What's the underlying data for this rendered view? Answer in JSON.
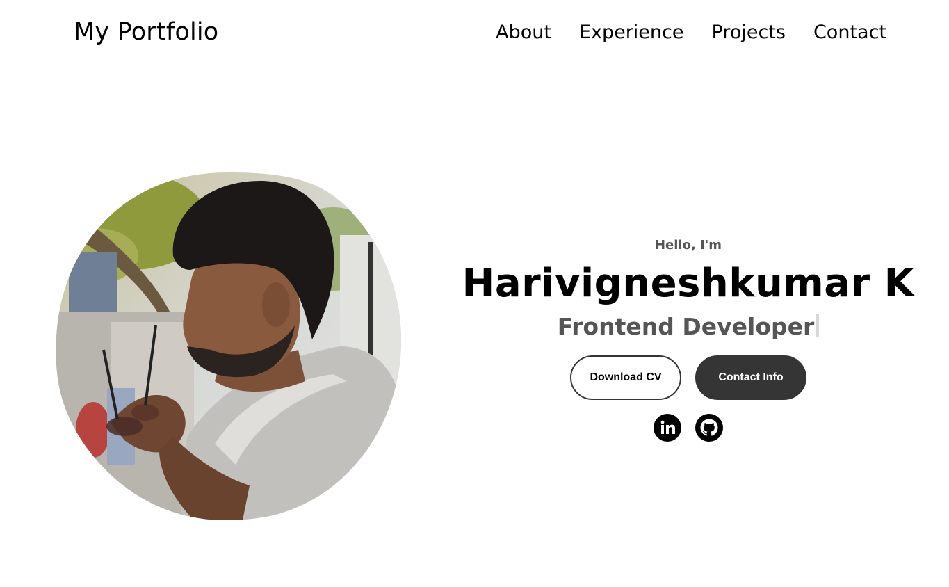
{
  "header": {
    "logo": "My Portfolio",
    "nav": [
      {
        "label": "About"
      },
      {
        "label": "Experience"
      },
      {
        "label": "Projects"
      },
      {
        "label": "Contact"
      }
    ]
  },
  "hero": {
    "greeting": "Hello, I'm",
    "name": "Harivigneshkumar K",
    "role": "Frontend Developer",
    "buttons": {
      "download": "Download CV",
      "contact": "Contact Info"
    },
    "socials": [
      {
        "icon": "linkedin-icon"
      },
      {
        "icon": "github-icon"
      }
    ]
  },
  "colors": {
    "button_dark": "#353535",
    "subtext": "#555555"
  }
}
